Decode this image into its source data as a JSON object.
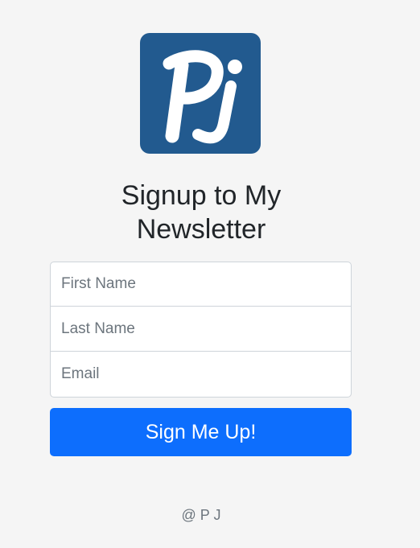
{
  "logo": {
    "text": "Pj",
    "icon": "pj-logo-icon",
    "background_color": "#225a8f"
  },
  "heading": {
    "line1": "Signup to My",
    "line2": "Newsletter"
  },
  "form": {
    "first_name_placeholder": "First Name",
    "last_name_placeholder": "Last Name",
    "email_placeholder": "Email",
    "first_name_value": "",
    "last_name_value": "",
    "email_value": ""
  },
  "submit": {
    "label": "Sign Me Up!",
    "color": "#0d6efd"
  },
  "footer": {
    "text": "@ P J"
  }
}
